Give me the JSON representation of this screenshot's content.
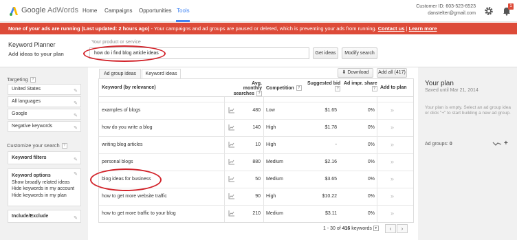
{
  "brand": {
    "google": "Google",
    "product": "AdWords"
  },
  "nav": {
    "home": "Home",
    "campaigns": "Campaigns",
    "opportunities": "Opportunities",
    "tools": "Tools"
  },
  "account": {
    "customer_id": "Customer ID: 603-523-6523",
    "email": "danstelter@gmail.com"
  },
  "notification_count": "1",
  "alert": {
    "bold": "None of your ads are running (Last updated: 2 hours ago)",
    "text": " - Your campaigns and ad groups are paused or deleted, which is preventing your ads from running.",
    "contact": "Contact us",
    "sep": "|",
    "learn": "Learn more"
  },
  "planner": {
    "title": "Keyword Planner",
    "subtitle": "Add ideas to your plan",
    "product_label": "Your product or service",
    "query": "how do i find blog article ideas",
    "get_ideas": "Get ideas",
    "modify_search": "Modify search"
  },
  "sidebar": {
    "targeting": "Targeting",
    "targets": [
      "United States",
      "All languages",
      "Google",
      "Negative keywords"
    ],
    "customize": "Customize your search",
    "keyword_filters": "Keyword filters",
    "keyword_options": {
      "title": "Keyword options",
      "items": [
        "Show broadly related ideas",
        "Hide keywords in my account",
        "Hide keywords in my plan"
      ]
    },
    "include_exclude": "Include/Exclude"
  },
  "tabs": {
    "ad_group": "Ad group ideas",
    "keyword": "Keyword ideas"
  },
  "toolbar": {
    "download": "Download",
    "add_all": "Add all (417)"
  },
  "columns": {
    "keyword": "Keyword (by relevance)",
    "searches_1": "Avg. monthly",
    "searches_2": "searches",
    "competition": "Competition",
    "bid": "Suggested bid",
    "share_1": "Ad impr. share",
    "add": "Add to plan"
  },
  "rows": [
    {
      "keyword": "examples of blogs",
      "searches": "480",
      "competition": "Low",
      "bid": "$1.65",
      "share": "0%"
    },
    {
      "keyword": "how do you write a blog",
      "searches": "140",
      "competition": "High",
      "bid": "$1.78",
      "share": "0%"
    },
    {
      "keyword": "writing blog articles",
      "searches": "10",
      "competition": "High",
      "bid": "-",
      "share": "0%"
    },
    {
      "keyword": "personal blogs",
      "searches": "880",
      "competition": "Medium",
      "bid": "$2.16",
      "share": "0%"
    },
    {
      "keyword": "blog ideas for business",
      "searches": "50",
      "competition": "Medium",
      "bid": "$3.65",
      "share": "0%"
    },
    {
      "keyword": "how to get more website traffic",
      "searches": "90",
      "competition": "High",
      "bid": "$10.22",
      "share": "0%"
    },
    {
      "keyword": "how to get more traffic to your blog",
      "searches": "210",
      "competition": "Medium",
      "bid": "$3.11",
      "share": "0%"
    }
  ],
  "pager": {
    "range": "1 - 30 of",
    "total": "416",
    "unit": "keywords"
  },
  "plan": {
    "title": "Your plan",
    "saved": "Saved until Mar 21, 2014",
    "empty": "Your plan is empty. Select an ad group idea or click \"+\" to start building a new ad group.",
    "ad_groups_label": "Ad groups:",
    "ad_groups_value": "0"
  },
  "colors": {
    "alert": "#dd4b39",
    "accent": "#4285f4",
    "highlight": "#d2232a"
  }
}
